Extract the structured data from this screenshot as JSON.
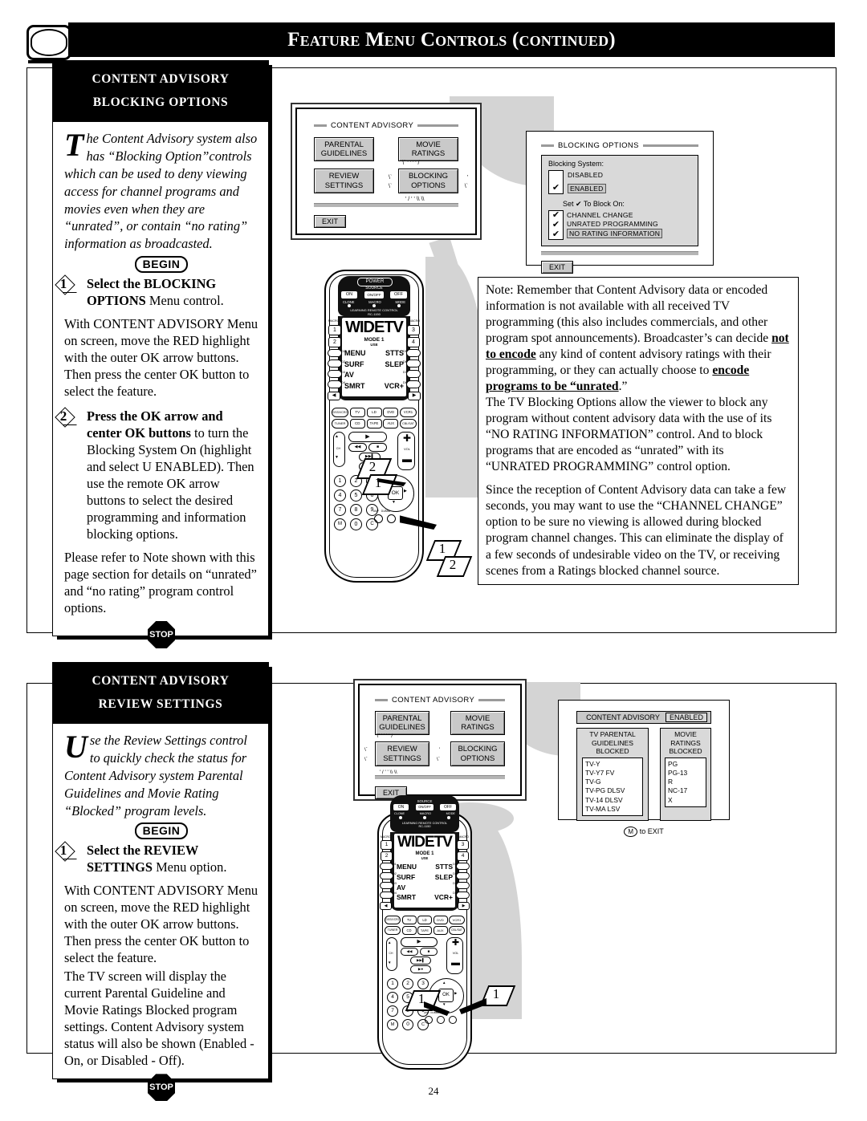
{
  "page": {
    "title": "Feature Menu Controls (continued)",
    "number": "24",
    "tv_icon": "tv-screen-icon"
  },
  "section1": {
    "heading_line1": "CONTENT ADVISORY",
    "heading_line2": "BLOCKING OPTIONS",
    "intro_dropcap": "T",
    "intro_text": "he Content Advisory system also has “Blocking Option”controls which can be used to deny viewing access for channel programs and movies even when they are “unrated”, or contain “no rating” information as broadcasted.",
    "begin_label": "BEGIN",
    "stop_label": "STOP",
    "steps": [
      {
        "number": "1",
        "bold_lead": "Select the BLOCKING OPTIONS",
        "rest": " Menu control.",
        "paragraphs": [
          "With CONTENT ADVISORY Menu on screen, move the RED highlight with the outer OK arrow buttons. Then press the center OK button to select the feature."
        ]
      },
      {
        "number": "2",
        "bold_lead": "Press the OK arrow and center OK buttons",
        "rest": " to turn the Blocking System On (highlight and select U  ENABLED). Then use the remote OK arrow buttons to select the desired programming and information blocking options.",
        "paragraphs": [
          "Please refer to Note shown with this page section for details on “unrated” and “no rating” program control options."
        ]
      }
    ],
    "menu_screen": {
      "title": "CONTENT ADVISORY",
      "buttons": [
        "PARENTAL GUIDELINES",
        "MOVIE RATINGS",
        "REVIEW SETTINGS",
        "BLOCKING OPTIONS"
      ],
      "selected": "BLOCKING OPTIONS",
      "exit": "EXIT"
    },
    "blocking_screen": {
      "title": "BLOCKING OPTIONS",
      "system_label": "Blocking System:",
      "system_options": [
        {
          "label": "DISABLED",
          "checked": false,
          "highlight": false
        },
        {
          "label": "ENABLED",
          "checked": true,
          "highlight": true
        }
      ],
      "set_label": "Set ✔ To Block On:",
      "block_options": [
        {
          "label": "CHANNEL CHANGE",
          "checked": true,
          "highlight": false
        },
        {
          "label": "UNRATED PROGRAMMING",
          "checked": true,
          "highlight": false
        },
        {
          "label": "NO RATING INFORMATION",
          "checked": true,
          "highlight": true
        }
      ],
      "exit": "EXIT"
    },
    "note": {
      "p1_a": "Note: Remember that Content Advisory data or encoded information is not available with all received TV programming (this also includes commercials, and other program spot announcements). Broadcaster’s can decide ",
      "p1_b": "not to encode",
      "p1_c": " any kind of content advisory ratings with their programming, or they can actually choose to ",
      "p1_d": "encode programs to be “unrated",
      "p1_e": ".”",
      "p2": "The TV Blocking Options allow the viewer to block any program without content advisory data with the use of its “NO RATING INFORMATION” control. And to block programs that are encoded as “unrated” with its “UNRATED PROGRAMMING” control option.",
      "p3": "Since the reception of Content Advisory data can take a few seconds, you may want to use the “CHANNEL CHANGE” option to be sure no viewing is allowed during blocked program channel changes. This can eliminate the display of a few seconds of undesirable video on the TV, or receiving scenes from a Ratings blocked channel source."
    },
    "callouts": [
      "2",
      "1",
      "1",
      "2"
    ]
  },
  "section2": {
    "heading_line1": "CONTENT ADVISORY",
    "heading_line2": "REVIEW SETTINGS",
    "intro_dropcap": "U",
    "intro_text": "se the Review Settings control to quickly check the status for Content Advisory system Parental Guidelines and Movie Rating “Blocked” program levels.",
    "begin_label": "BEGIN",
    "stop_label": "STOP",
    "steps": [
      {
        "number": "1",
        "bold_lead": "Select the REVIEW SETTINGS",
        "rest": " Menu option.",
        "paragraphs": [
          "With CONTENT ADVISORY Menu on screen, move the RED highlight with the outer OK arrow buttons. Then press the center OK button to select the feature.",
          "The TV screen will display the current Parental Guideline and Movie Ratings Blocked program settings. Content Advisory system status will also be shown (Enabled -On, or Disabled - Off)."
        ]
      }
    ],
    "menu_screen": {
      "title": "CONTENT ADVISORY",
      "buttons": [
        "PARENTAL GUIDELINES",
        "MOVIE RATINGS",
        "REVIEW SETTINGS",
        "BLOCKING OPTIONS"
      ],
      "selected": "REVIEW SETTINGS",
      "exit": "EXIT"
    },
    "review_screen": {
      "header_label": "CONTENT ADVISORY",
      "header_status": "ENABLED",
      "col1_title": "TV PARENTAL GUIDELINES BLOCKED",
      "col1_items": [
        "TV-Y",
        "TV-Y7  FV",
        "TV-G",
        "TV-PG DLSV",
        "TV-14  DLSV",
        "TV-MA   LSV"
      ],
      "col2_title": "MOVIE RATINGS BLOCKED",
      "col2_items": [
        "PG",
        "PG-13",
        "R",
        "NC-17",
        "X"
      ],
      "footer_key": "M",
      "footer_text": "to EXIT"
    },
    "callouts": [
      "1",
      "1"
    ]
  },
  "remote": {
    "power_label": "POWER",
    "source_label": "SOURCE",
    "power_buttons": [
      "ON",
      "ON/OFF",
      "OFF"
    ],
    "indicators": [
      "CLONE",
      "MACRO",
      "MODE"
    ],
    "brand_line1": "LEARNING REMOTE CONTROL",
    "brand_line2": "RC-1150",
    "lcd_brand": "WIDETV",
    "lcd_mode": "MODE  1",
    "lcd_use": "USE",
    "lcd_left": [
      "MENU",
      "SURF",
      "AV",
      "SMRT"
    ],
    "lcd_right": [
      "STTS",
      "SLEP",
      "",
      "VCR+"
    ],
    "dcodes_left": [
      "D1",
      "D2",
      "D3",
      "D4"
    ],
    "dcodes_right": [
      "D5",
      "D6",
      "D7",
      "D8"
    ],
    "macro_label": "MACRO",
    "side_numbers_left": [
      "1",
      "2"
    ],
    "side_numbers_right": [
      "3",
      "4"
    ],
    "device_row1": [
      "DSS/VCR2",
      "TV",
      "LD",
      "DVD",
      "VCR1"
    ],
    "device_row2": [
      "TUNER",
      "CD",
      "TAPE",
      "AUX",
      "CBL/SAT"
    ],
    "vol_label": "VOL",
    "ch_label": "CH",
    "ok_label": "OK",
    "keypad": [
      "1",
      "2",
      "3",
      "4",
      "5",
      "6",
      "7",
      "8",
      "9",
      "M",
      "0",
      "C"
    ],
    "small_labels": [
      "AMP",
      "DUBBD",
      "MUTE"
    ]
  }
}
